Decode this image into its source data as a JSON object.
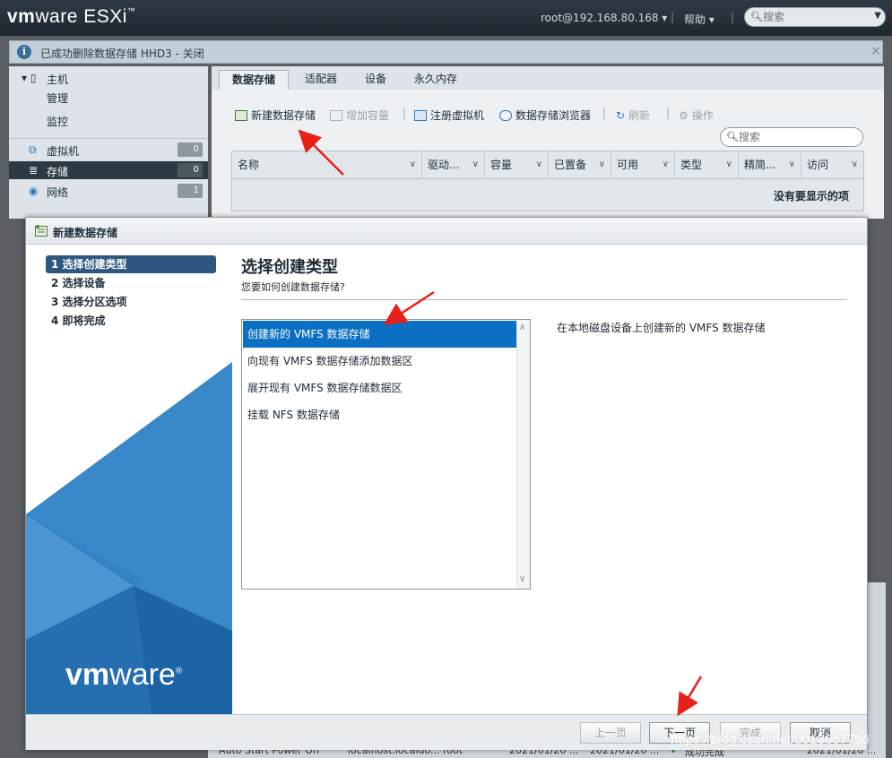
{
  "topbar": {
    "logo_vm": "vm",
    "logo_ware": "ware",
    "logo_esxi": " ESXi",
    "logo_tm": "™",
    "user": "root@192.168.80.168 ▾",
    "help": "帮助 ▾",
    "search_placeholder": "搜索"
  },
  "notification": {
    "message": "已成功删除数据存储 HHD3 - 关闭",
    "close": "×"
  },
  "navigator": {
    "host": "主机",
    "manage": "管理",
    "monitor": "监控",
    "vms": "虚拟机",
    "vms_count": "0",
    "storage": "存储",
    "storage_count": "0",
    "network": "网络",
    "network_count": "1"
  },
  "main": {
    "tabs": [
      "数据存储",
      "适配器",
      "设备",
      "永久内存"
    ],
    "toolbar": {
      "new_datastore": "新建数据存储",
      "increase_capacity": "增加容量",
      "register_vm": "注册虚拟机",
      "datastore_browser": "数据存储浏览器",
      "refresh": "刷新",
      "actions": "操作"
    },
    "table_search_placeholder": "搜索",
    "columns": [
      "名称",
      "驱动...",
      "容量",
      "已置备",
      "可用",
      "类型",
      "精简...",
      "访问"
    ],
    "empty_text": "没有要显示的项"
  },
  "background_rows": {
    "task": "Auto Start Power On",
    "target": "localhost.localdo...",
    "initiator": "root",
    "queued": "2021/01/20 ...",
    "started": "2021/01/20 ...",
    "result": "成功完成",
    "completed": "2021/01/20 ..."
  },
  "dialog": {
    "title": "新建数据存储",
    "steps": [
      "1 选择创建类型",
      "2 选择设备",
      "3 选择分区选项",
      "4 即将完成"
    ],
    "active_step": 0,
    "heading": "选择创建类型",
    "subheading": "您要如何创建数据存储?",
    "options": [
      "创建新的 VMFS 数据存储",
      "向现有 VMFS 数据存储添加数据区",
      "展开现有 VMFS 数据存储数据区",
      "挂载 NFS 数据存储"
    ],
    "selected_option": 0,
    "description": "在本地磁盘设备上创建新的 VMFS 数据存储",
    "buttons": {
      "back": "上一页",
      "next": "下一页",
      "finish": "完成",
      "cancel": "取消"
    },
    "logo_vm": "vm",
    "logo_ware": "ware",
    "logo_reg": "®"
  },
  "watermark": "https://blog.csdn.net/u013667796",
  "colors": {
    "topbar": "#2f3a45",
    "accent_selected": "#0b6fc4",
    "step_active": "#2f5680",
    "annotation_arrow": "#e8201a"
  }
}
